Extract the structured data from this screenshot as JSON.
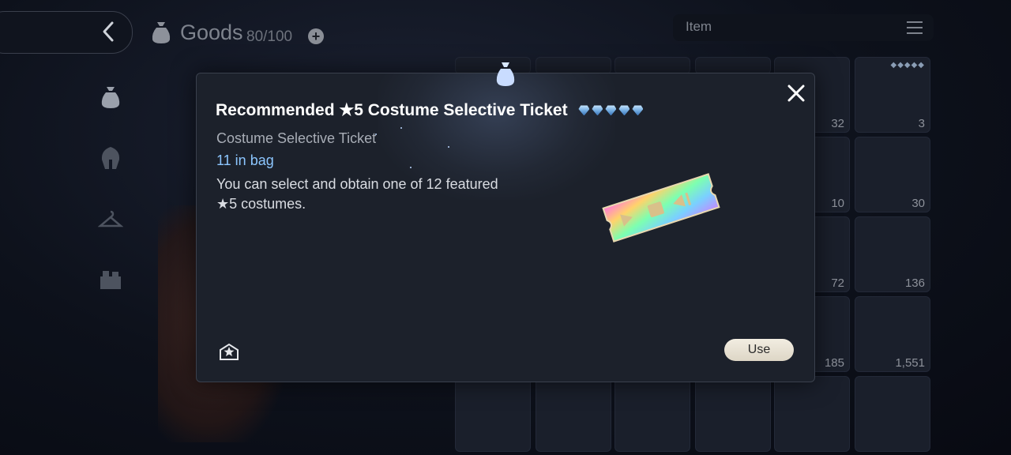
{
  "header": {
    "title": "Goods",
    "count": "80/100",
    "plus_label": "+",
    "filter_label": "Item"
  },
  "sidebar": {
    "icons": [
      "bag-icon",
      "helmet-icon",
      "hanger-icon",
      "chest-icon"
    ]
  },
  "grid": {
    "visible_counts": [
      "32",
      "3",
      "10",
      "30",
      "72",
      "136",
      "185",
      "1,551"
    ]
  },
  "modal": {
    "title": "Recommended ★5 Costume Selective Ticket",
    "star_rating": 5,
    "subtype": "Costume Selective Ticket",
    "bag_count": "11 in bag",
    "description": "You can select and obtain one of 12 featured ★5 costumes.",
    "use_label": "Use",
    "close_icon": "close-icon",
    "bottom_icon": "star-envelope-icon"
  },
  "colors": {
    "accent_blue": "#8cc6ff",
    "modal_bg": "#1c212b",
    "button_bg": "#ece6da"
  }
}
